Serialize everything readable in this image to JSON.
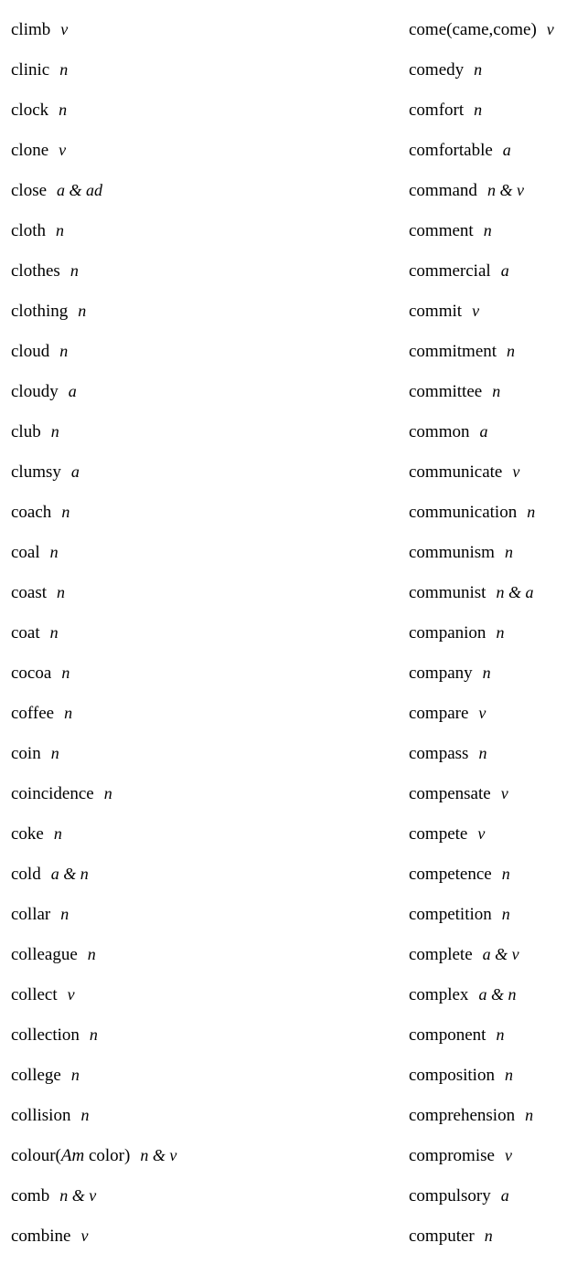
{
  "document": {
    "type": "vocabulary-word-list",
    "layout": "two-column",
    "rows_per_column": 31,
    "background_color": "#ffffff",
    "text_color": "#000000",
    "left_column": [
      {
        "word": "climb",
        "pos": "v"
      },
      {
        "word": "clinic",
        "pos": "n"
      },
      {
        "word": "clock",
        "pos": "n"
      },
      {
        "word": "clone",
        "pos": "v"
      },
      {
        "word": "close",
        "pos": "a & ad"
      },
      {
        "word": "cloth",
        "pos": "n"
      },
      {
        "word": "clothes",
        "pos": "n"
      },
      {
        "word": "clothing",
        "pos": "n"
      },
      {
        "word": "cloud",
        "pos": "n"
      },
      {
        "word": "cloudy",
        "pos": "a"
      },
      {
        "word": "club",
        "pos": "n"
      },
      {
        "word": "clumsy",
        "pos": "a"
      },
      {
        "word": "coach",
        "pos": "n"
      },
      {
        "word": "coal",
        "pos": "n"
      },
      {
        "word": "coast",
        "pos": "n"
      },
      {
        "word": "coat",
        "pos": "n"
      },
      {
        "word": "cocoa",
        "pos": "n"
      },
      {
        "word": "coffee",
        "pos": "n"
      },
      {
        "word": "coin",
        "pos": "n"
      },
      {
        "word": "coincidence",
        "pos": "n"
      },
      {
        "word": "coke",
        "pos": "n"
      },
      {
        "word": "cold",
        "pos": "a & n"
      },
      {
        "word": "collar",
        "pos": "n"
      },
      {
        "word": "colleague",
        "pos": "n"
      },
      {
        "word": "collect",
        "pos": "v"
      },
      {
        "word": "collection",
        "pos": "n"
      },
      {
        "word": "college",
        "pos": "n"
      },
      {
        "word": "collision",
        "pos": "n"
      },
      {
        "word": "colour",
        "word_prefix": "colour(",
        "word_italic": "Am",
        "word_suffix": " color)",
        "pos": "n & v"
      },
      {
        "word": "comb",
        "pos": "n & v"
      },
      {
        "word": "combine",
        "pos": "v"
      }
    ],
    "right_column": [
      {
        "word": "come(came,come)",
        "pos": "v"
      },
      {
        "word": "comedy",
        "pos": "n"
      },
      {
        "word": "comfort",
        "pos": "n"
      },
      {
        "word": "comfortable",
        "pos": "a"
      },
      {
        "word": "command",
        "pos": "n & v"
      },
      {
        "word": "comment",
        "pos": "n"
      },
      {
        "word": "commercial",
        "pos": "a"
      },
      {
        "word": "commit",
        "pos": "v"
      },
      {
        "word": "commitment",
        "pos": "n"
      },
      {
        "word": "committee",
        "pos": "n"
      },
      {
        "word": "common",
        "pos": "a"
      },
      {
        "word": "communicate",
        "pos": "v"
      },
      {
        "word": "communication",
        "pos": "n"
      },
      {
        "word": "communism",
        "pos": "n"
      },
      {
        "word": "communist",
        "pos": "n & a"
      },
      {
        "word": "companion",
        "pos": "n"
      },
      {
        "word": "company",
        "pos": "n"
      },
      {
        "word": "compare",
        "pos": "v"
      },
      {
        "word": "compass",
        "pos": "n"
      },
      {
        "word": "compensate",
        "pos": "v"
      },
      {
        "word": "compete",
        "pos": "v"
      },
      {
        "word": "competence",
        "pos": "n"
      },
      {
        "word": "competition",
        "pos": "n"
      },
      {
        "word": "complete",
        "pos": "a & v"
      },
      {
        "word": "complex",
        "pos": "a & n"
      },
      {
        "word": "component",
        "pos": "n"
      },
      {
        "word": "composition",
        "pos": "n"
      },
      {
        "word": "comprehension",
        "pos": "n"
      },
      {
        "word": "compromise",
        "pos": "v"
      },
      {
        "word": "compulsory",
        "pos": "a"
      },
      {
        "word": "computer",
        "pos": "n"
      }
    ]
  }
}
